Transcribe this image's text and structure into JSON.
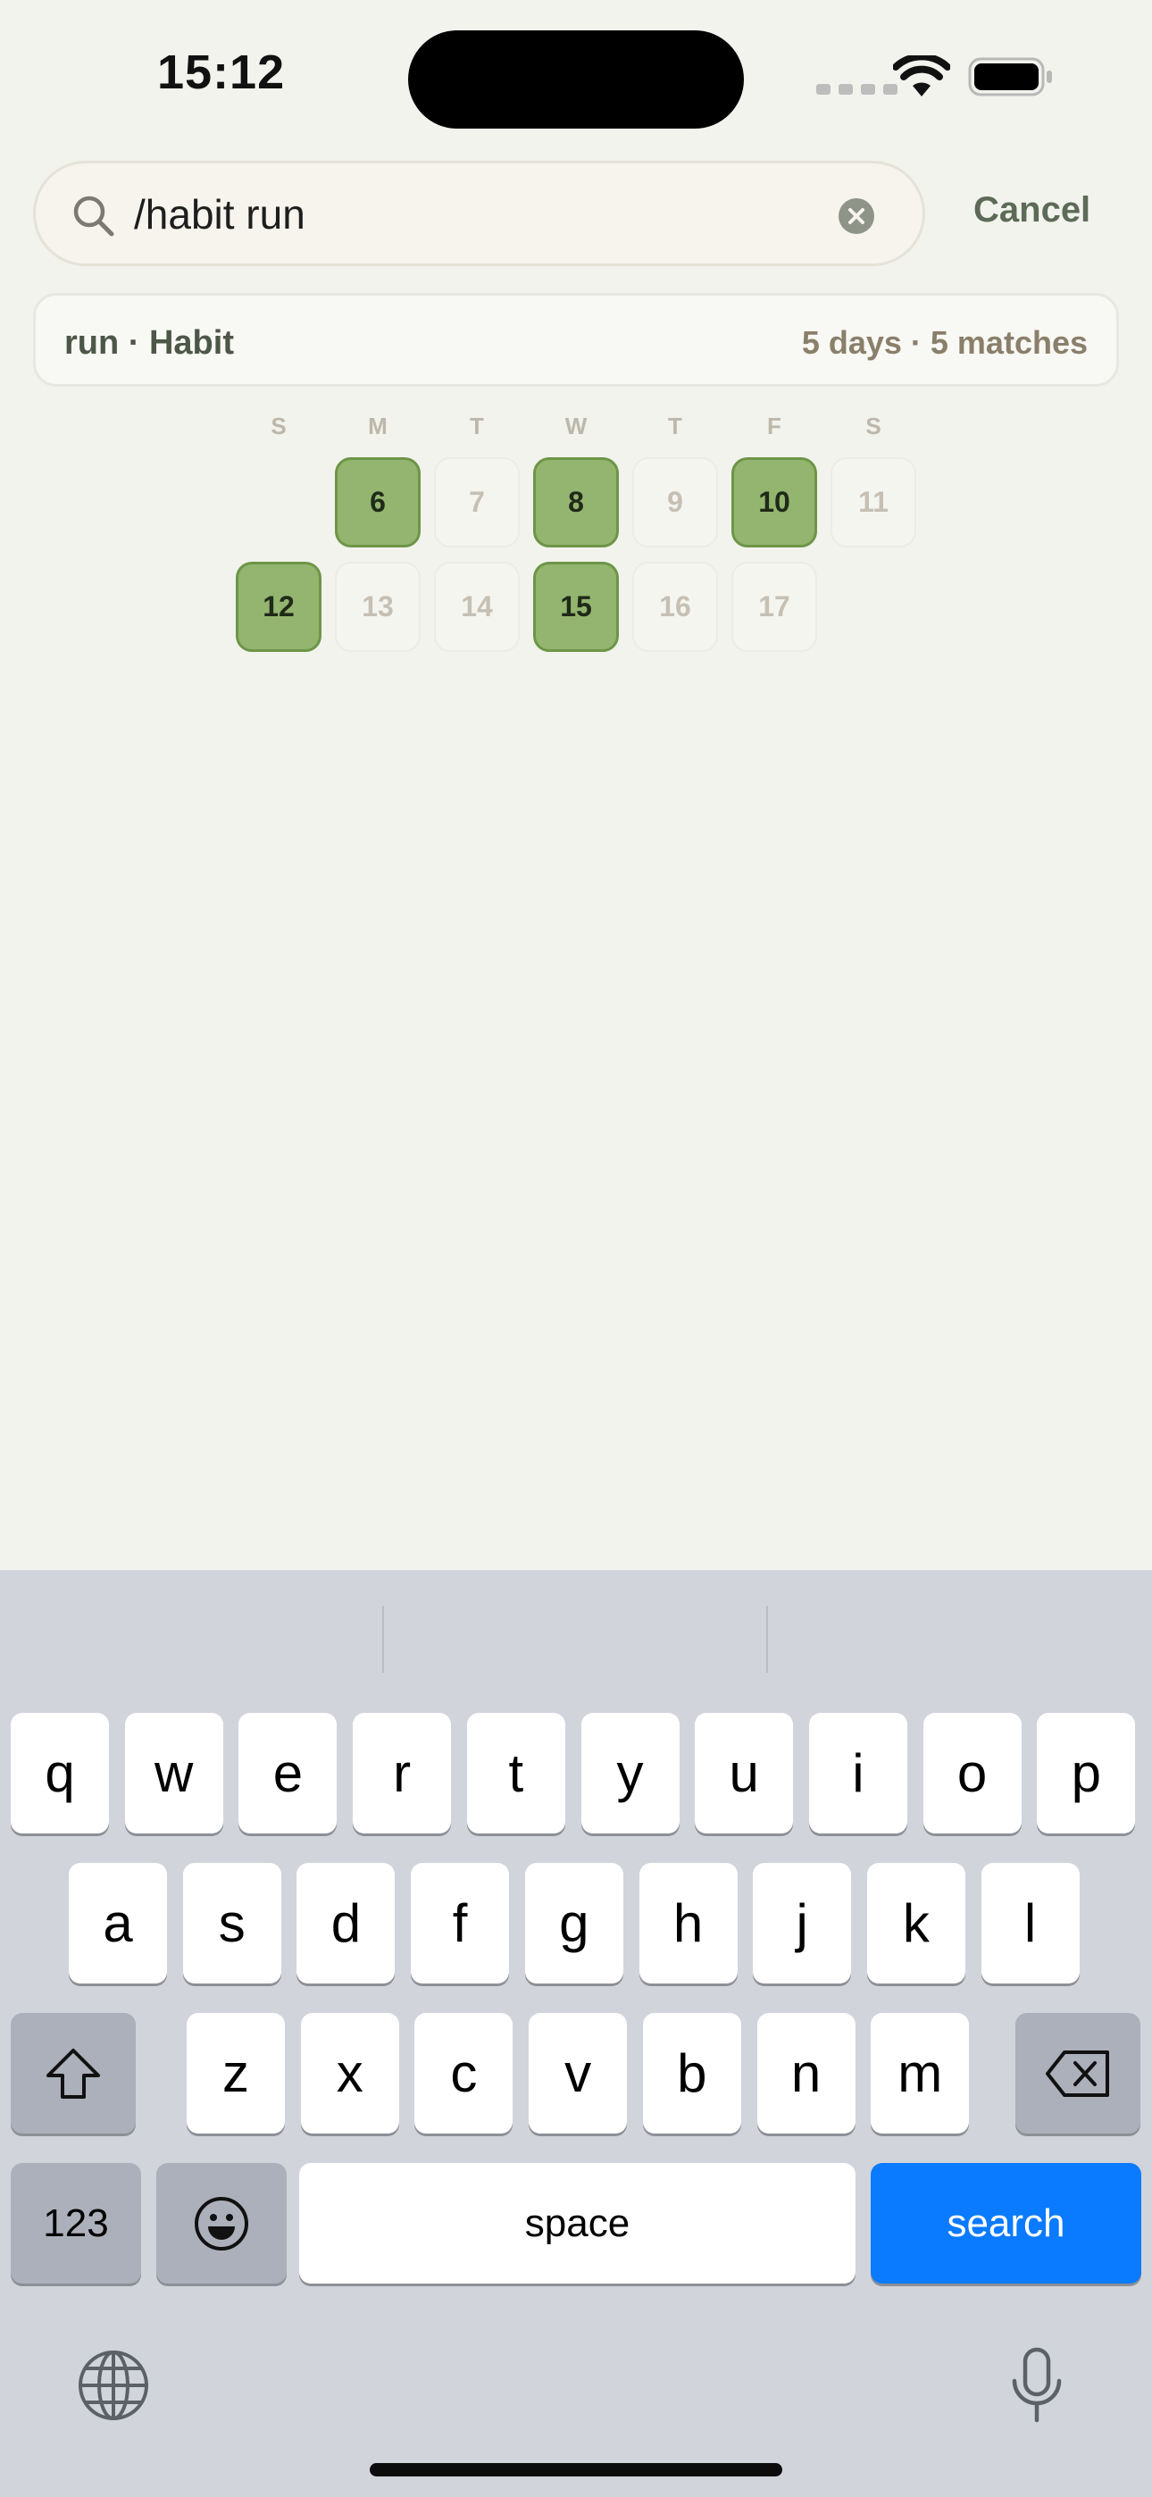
{
  "status_bar": {
    "time": "15:12"
  },
  "search": {
    "value": "/habit run",
    "cancel_label": "Cancel"
  },
  "result": {
    "title": "run · Habit",
    "summary": "5 days · 5 matches"
  },
  "calendar": {
    "weekdays": [
      "S",
      "M",
      "T",
      "W",
      "T",
      "F",
      "S"
    ],
    "weeks": [
      [
        null,
        {
          "day": "6",
          "active": true
        },
        {
          "day": "7",
          "active": false
        },
        {
          "day": "8",
          "active": true
        },
        {
          "day": "9",
          "active": false
        },
        {
          "day": "10",
          "active": true
        },
        {
          "day": "11",
          "active": false
        }
      ],
      [
        {
          "day": "12",
          "active": true
        },
        {
          "day": "13",
          "active": false
        },
        {
          "day": "14",
          "active": false
        },
        {
          "day": "15",
          "active": true
        },
        {
          "day": "16",
          "active": false
        },
        {
          "day": "17",
          "active": false
        },
        null
      ]
    ]
  },
  "keyboard": {
    "row1": [
      "q",
      "w",
      "e",
      "r",
      "t",
      "y",
      "u",
      "i",
      "o",
      "p"
    ],
    "row2": [
      "a",
      "s",
      "d",
      "f",
      "g",
      "h",
      "j",
      "k",
      "l"
    ],
    "row3": [
      "z",
      "x",
      "c",
      "v",
      "b",
      "n",
      "m"
    ],
    "numbers_label": "123",
    "space_label": "space",
    "search_label": "search"
  },
  "colors": {
    "accent": "#0a7aff",
    "habit_done": "#93b56f",
    "background": "#f1f3ec"
  }
}
